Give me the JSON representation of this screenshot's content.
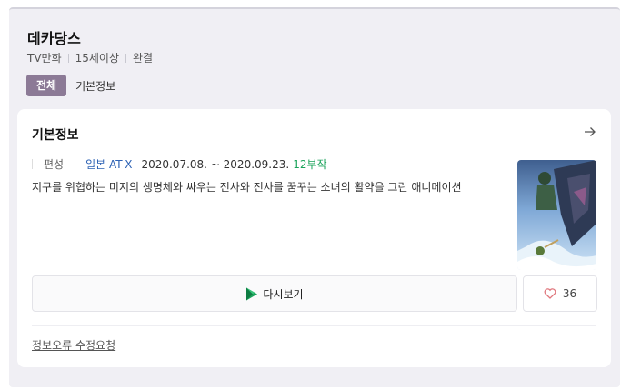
{
  "header": {
    "title": "데카당스",
    "meta": [
      "TV만화",
      "15세이상",
      "완결"
    ]
  },
  "tabs": [
    {
      "label": "전체",
      "active": true
    },
    {
      "label": "기본정보",
      "active": false
    }
  ],
  "info_card": {
    "title": "기본정보",
    "arrow_icon": "arrow-right-icon",
    "schedule_label": "편성",
    "network": "일본 AT-X",
    "date_range": "2020.07.08. ~ 2020.09.23.",
    "episodes": "12부작",
    "description": "지구를 위협하는 미지의 생명체와 싸우는 전사와 전사를 꿈꾸는 소녀의 활약을 그린 애니메이션",
    "replay_label": "다시보기",
    "replay_icon": "play-store-icon",
    "like_icon": "heart-icon",
    "like_count": "36",
    "report_link": "정보오류 수정요청"
  },
  "colors": {
    "panel_bg": "#f0eff4",
    "tab_active_bg": "#8c7a96",
    "network_blue": "#2d62b4",
    "episodes_green": "#1aa35a",
    "like_heart": "#e0777d"
  }
}
